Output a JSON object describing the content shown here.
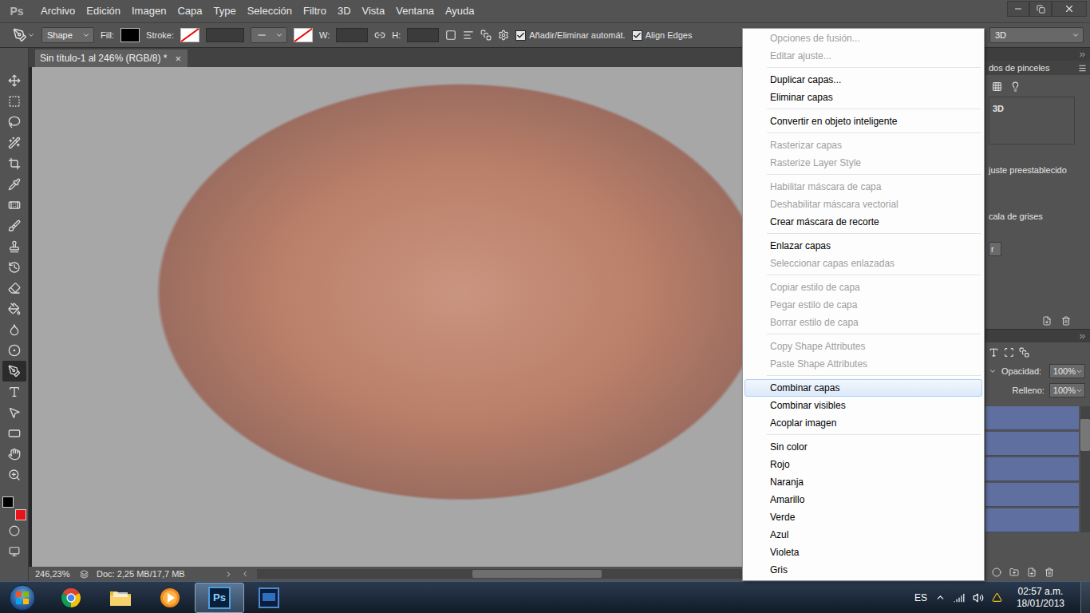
{
  "app": {
    "logo": "Ps"
  },
  "menu_bar": [
    "Archivo",
    "Edición",
    "Imagen",
    "Capa",
    "Type",
    "Selección",
    "Filtro",
    "3D",
    "Vista",
    "Ventana",
    "Ayuda"
  ],
  "options_bar": {
    "mode": "Shape",
    "fill_label": "Fill:",
    "fill_color": "#000000",
    "stroke_label": "Stroke:",
    "w_label": "W:",
    "h_label": "H:",
    "checkboxes": [
      {
        "label": "Añadir/Eliminar automát.",
        "checked": true
      },
      {
        "label": "Align Edges",
        "checked": true
      }
    ],
    "workspace": "3D"
  },
  "tools": [
    {
      "selected": false
    },
    {
      "selected": false
    },
    {
      "selected": false
    },
    {
      "selected": false
    },
    {
      "selected": false
    },
    {
      "selected": false
    },
    {
      "selected": false
    },
    {
      "selected": false
    },
    {
      "selected": false
    },
    {
      "selected": false
    },
    {
      "selected": false
    },
    {
      "selected": false
    },
    {
      "selected": false
    },
    {
      "selected": false
    },
    {
      "selected": true
    },
    {
      "selected": false
    },
    {
      "selected": false
    },
    {
      "selected": false
    },
    {
      "selected": false
    },
    {
      "selected": false
    }
  ],
  "colors": {
    "foreground": "#000000",
    "background": "#e8141b"
  },
  "document": {
    "tab": "Sin título-1 al 246% (RGB/8) *",
    "close": "×",
    "zoom": "246,23%",
    "doc_info": "Doc: 2,25 MB/17,7 MB"
  },
  "context_menu": {
    "groups": [
      {
        "items": [
          {
            "label": "Opciones de fusión...",
            "disabled": true,
            "selected": false
          },
          {
            "label": "Editar ajuste...",
            "disabled": true,
            "selected": false
          }
        ]
      },
      {
        "items": [
          {
            "label": "Duplicar capas...",
            "disabled": false,
            "selected": false
          },
          {
            "label": "Eliminar capas",
            "disabled": false,
            "selected": false
          }
        ]
      },
      {
        "items": [
          {
            "label": "Convertir en objeto inteligente",
            "disabled": false,
            "selected": false
          }
        ]
      },
      {
        "items": [
          {
            "label": "Rasterizar capas",
            "disabled": true,
            "selected": false
          },
          {
            "label": "Rasterize Layer Style",
            "disabled": true,
            "selected": false
          }
        ]
      },
      {
        "items": [
          {
            "label": "Habilitar máscara de capa",
            "disabled": true,
            "selected": false
          },
          {
            "label": "Deshabilitar máscara vectorial",
            "disabled": true,
            "selected": false
          },
          {
            "label": "Crear máscara de recorte",
            "disabled": false,
            "selected": false
          }
        ]
      },
      {
        "items": [
          {
            "label": "Enlazar capas",
            "disabled": false,
            "selected": false
          },
          {
            "label": "Seleccionar capas enlazadas",
            "disabled": true,
            "selected": false
          }
        ]
      },
      {
        "items": [
          {
            "label": "Copiar estilo de capa",
            "disabled": true,
            "selected": false
          },
          {
            "label": "Pegar estilo de capa",
            "disabled": true,
            "selected": false
          },
          {
            "label": "Borrar estilo de capa",
            "disabled": true,
            "selected": false
          }
        ]
      },
      {
        "items": [
          {
            "label": "Copy Shape Attributes",
            "disabled": true,
            "selected": false
          },
          {
            "label": "Paste Shape Attributes",
            "disabled": true,
            "selected": false
          }
        ]
      },
      {
        "items": [
          {
            "label": "Combinar capas",
            "disabled": false,
            "selected": true
          },
          {
            "label": "Combinar visibles",
            "disabled": false,
            "selected": false
          },
          {
            "label": "Acoplar imagen",
            "disabled": false,
            "selected": false
          }
        ]
      },
      {
        "items": [
          {
            "label": "Sin color",
            "disabled": false,
            "selected": false
          },
          {
            "label": "Rojo",
            "disabled": false,
            "selected": false
          },
          {
            "label": "Naranja",
            "disabled": false,
            "selected": false
          },
          {
            "label": "Amarillo",
            "disabled": false,
            "selected": false
          },
          {
            "label": "Verde",
            "disabled": false,
            "selected": false
          },
          {
            "label": "Azul",
            "disabled": false,
            "selected": false
          },
          {
            "label": "Violeta",
            "disabled": false,
            "selected": false
          },
          {
            "label": "Gris",
            "disabled": false,
            "selected": false
          }
        ]
      }
    ]
  },
  "right_panel": {
    "tab": "dos de pinceles",
    "title": "3D",
    "lines": [
      "juste preestablecido",
      "cala de grises"
    ],
    "button": "r"
  },
  "layers_panel": {
    "opacity_label": "Opacidad:",
    "opacity": "100%",
    "fill_label": "Relleno:",
    "fill": "100%",
    "layers": [
      {
        "selected": true
      },
      {
        "selected": true
      },
      {
        "selected": true
      },
      {
        "selected": true
      },
      {
        "selected": true
      }
    ]
  },
  "taskbar": {
    "apps": [
      {
        "kind": "chrome",
        "label": "",
        "active": false
      },
      {
        "kind": "explorer",
        "label": "",
        "active": false
      },
      {
        "kind": "media",
        "label": "",
        "active": false
      },
      {
        "kind": "photoshop",
        "label": "Ps",
        "active": true
      },
      {
        "kind": "app",
        "label": "",
        "active": false
      }
    ],
    "language": "ES",
    "time": "02:57 a.m.",
    "date": "18/01/2013"
  }
}
